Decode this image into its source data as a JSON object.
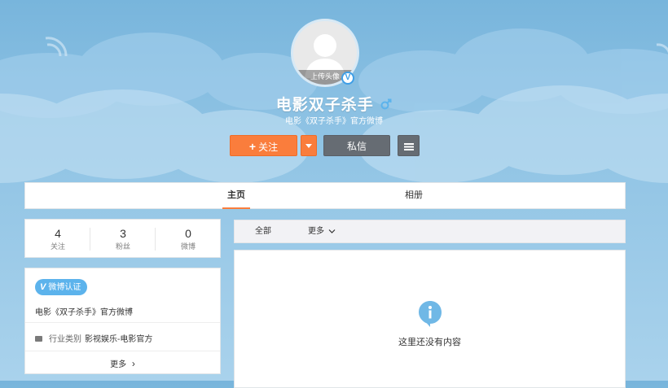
{
  "profile": {
    "avatar_overlay": "上传头像",
    "verify_badge": "V",
    "name": "电影双子杀手",
    "description": "电影《双子杀手》官方微博"
  },
  "actions": {
    "follow_plus": "+",
    "follow_label": "关注",
    "message_label": "私信"
  },
  "tabs": {
    "home": "主页",
    "album": "相册"
  },
  "stats": [
    {
      "value": "4",
      "label": "关注"
    },
    {
      "value": "3",
      "label": "粉丝"
    },
    {
      "value": "0",
      "label": "微博"
    }
  ],
  "info": {
    "tag_v": "V",
    "tag_label": "微博认证",
    "verify_text": "电影《双子杀手》官方微博",
    "industry_key": "行业类别",
    "industry_value": "影视娱乐-电影官方",
    "more_label": "更多",
    "more_chevron": "›"
  },
  "feed": {
    "filter_all": "全部",
    "filter_more": "更多",
    "empty_text": "这里还没有内容"
  },
  "colors": {
    "accent": "#fa7d3c",
    "dark_button": "#666c73",
    "verify_blue": "#5cb3ec"
  }
}
